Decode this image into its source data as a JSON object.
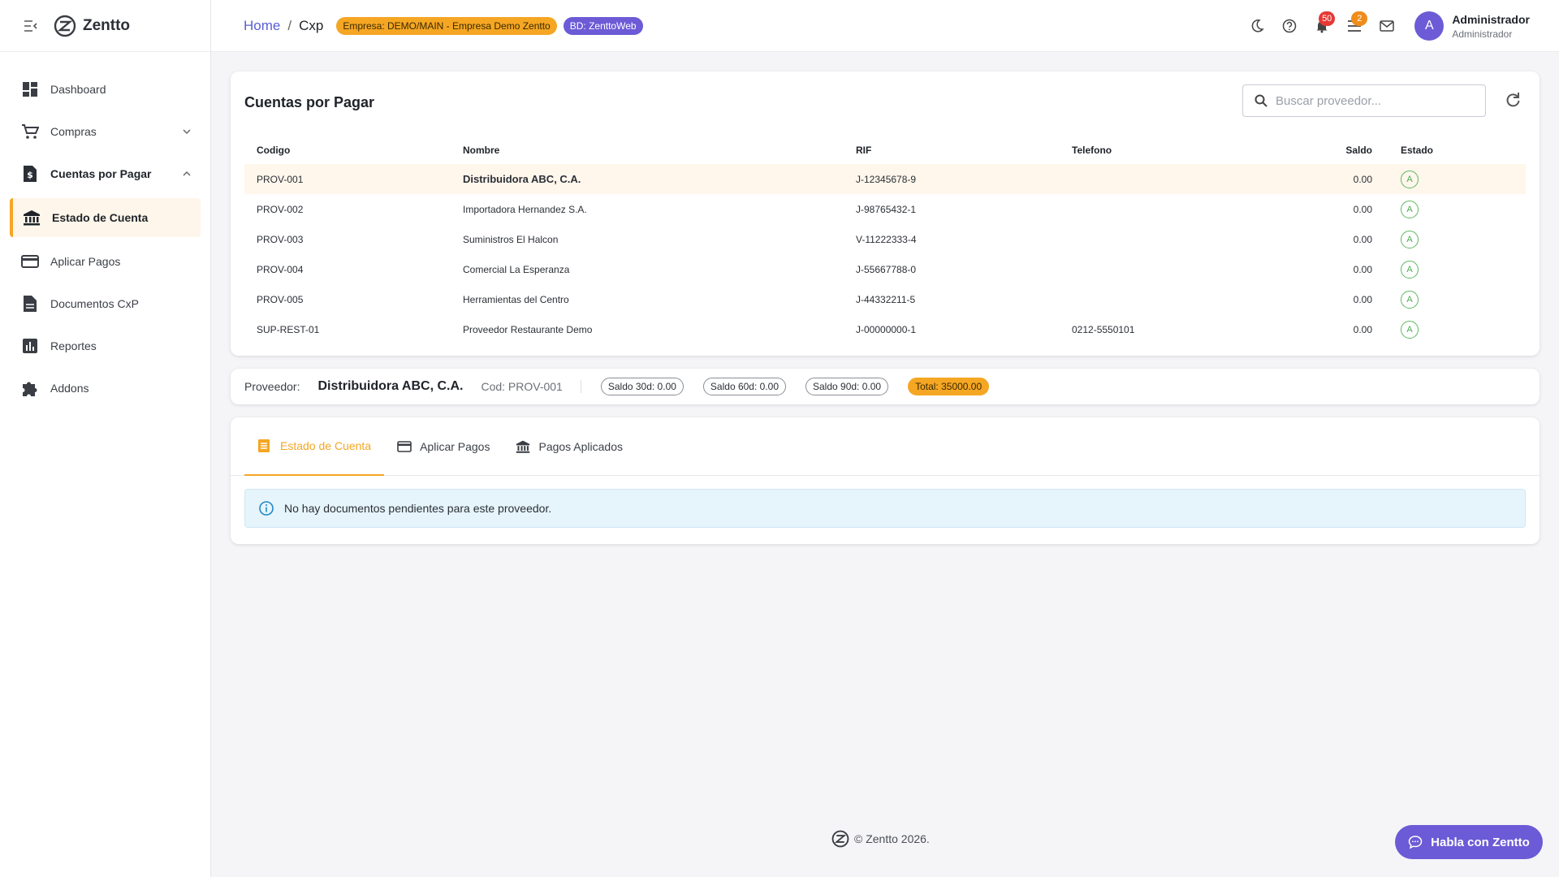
{
  "app": {
    "name": "Zentto"
  },
  "sidebar": {
    "items": [
      {
        "label": "Dashboard",
        "icon": "dashboard-icon"
      },
      {
        "label": "Compras",
        "icon": "cart-icon"
      },
      {
        "label": "Cuentas por Pagar",
        "icon": "invoice-icon"
      },
      {
        "label": "Estado de Cuenta",
        "icon": "bank-icon"
      },
      {
        "label": "Aplicar Pagos",
        "icon": "credit-card-icon"
      },
      {
        "label": "Documentos CxP",
        "icon": "document-icon"
      },
      {
        "label": "Reportes",
        "icon": "bar-chart-icon"
      },
      {
        "label": "Addons",
        "icon": "puzzle-icon"
      }
    ]
  },
  "header": {
    "breadcrumb": {
      "home": "Home",
      "sep": "/",
      "current": "Cxp"
    },
    "empresa_chip": "Empresa: DEMO/MAIN - Empresa Demo Zentto",
    "bd_chip": "BD: ZenttoWeb",
    "notifications_count": "50",
    "tasks_count": "2",
    "user": {
      "initial": "A",
      "name": "Administrador",
      "role": "Administrador"
    }
  },
  "list": {
    "title": "Cuentas por Pagar",
    "search_placeholder": "Buscar proveedor...",
    "columns": {
      "codigo": "Codigo",
      "nombre": "Nombre",
      "rif": "RIF",
      "telefono": "Telefono",
      "saldo": "Saldo",
      "estado": "Estado"
    },
    "rows": [
      {
        "codigo": "PROV-001",
        "nombre": "Distribuidora ABC, C.A.",
        "rif": "J-12345678-9",
        "telefono": "",
        "saldo": "0.00",
        "estado": "A"
      },
      {
        "codigo": "PROV-002",
        "nombre": "Importadora Hernandez S.A.",
        "rif": "J-98765432-1",
        "telefono": "",
        "saldo": "0.00",
        "estado": "A"
      },
      {
        "codigo": "PROV-003",
        "nombre": "Suministros El Halcon",
        "rif": "V-11222333-4",
        "telefono": "",
        "saldo": "0.00",
        "estado": "A"
      },
      {
        "codigo": "PROV-004",
        "nombre": "Comercial La Esperanza",
        "rif": "J-55667788-0",
        "telefono": "",
        "saldo": "0.00",
        "estado": "A"
      },
      {
        "codigo": "PROV-005",
        "nombre": "Herramientas del Centro",
        "rif": "J-44332211-5",
        "telefono": "",
        "saldo": "0.00",
        "estado": "A"
      },
      {
        "codigo": "SUP-REST-01",
        "nombre": "Proveedor Restaurante Demo",
        "rif": "J-00000000-1",
        "telefono": "0212-5550101",
        "saldo": "0.00",
        "estado": "A"
      }
    ]
  },
  "provider": {
    "label": "Proveedor:",
    "name": "Distribuidora ABC, C.A.",
    "cod": "Cod: PROV-001",
    "saldo30": "Saldo 30d: 0.00",
    "saldo60": "Saldo 60d: 0.00",
    "saldo90": "Saldo 90d: 0.00",
    "total": "Total: 35000.00"
  },
  "tabs": [
    {
      "label": "Estado de Cuenta",
      "icon": "list-icon"
    },
    {
      "label": "Aplicar Pagos",
      "icon": "credit-card-icon"
    },
    {
      "label": "Pagos Aplicados",
      "icon": "bank-icon"
    }
  ],
  "alert": {
    "text": "No hay documentos pendientes para este proveedor."
  },
  "footer": {
    "text": "© Zentto 2026."
  },
  "chat": {
    "label": "Habla con Zentto"
  },
  "colors": {
    "accent": "#f5a623",
    "brand": "#6b5bd6",
    "link": "#5a5fd6",
    "status_ok": "#4caf50"
  }
}
